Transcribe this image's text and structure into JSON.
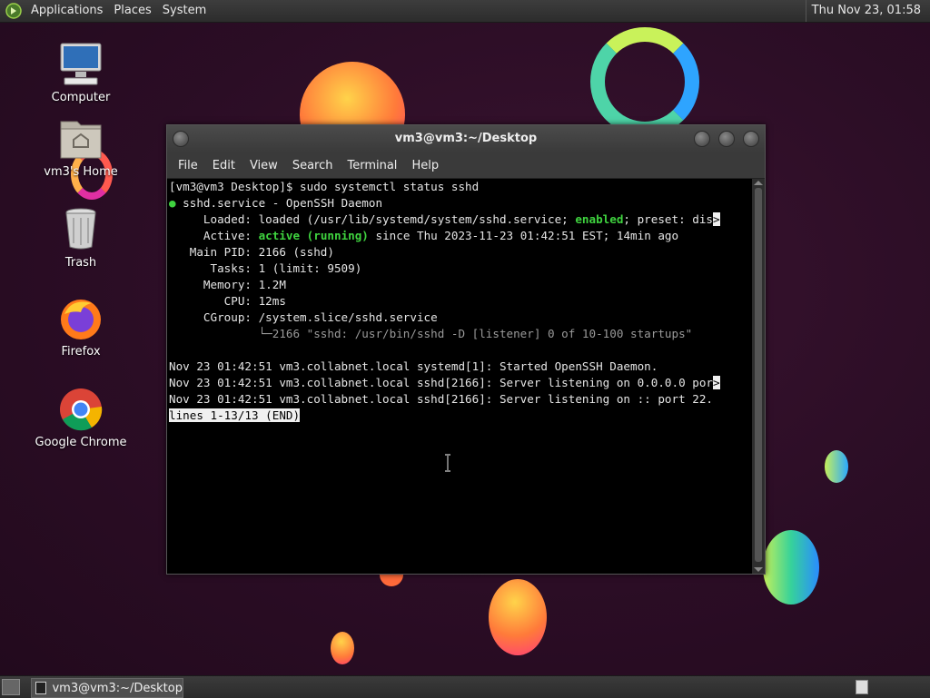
{
  "top_panel": {
    "menus": [
      "Applications",
      "Places",
      "System"
    ],
    "clock": "Thu Nov 23, 01:58"
  },
  "desktop_icons": [
    {
      "label": "Computer",
      "icon": "computer-icon"
    },
    {
      "label": "vm3's Home",
      "icon": "home-folder-icon"
    },
    {
      "label": "Trash",
      "icon": "trash-icon"
    },
    {
      "label": "Firefox",
      "icon": "firefox-icon"
    },
    {
      "label": "Google Chrome",
      "icon": "chrome-icon"
    }
  ],
  "window": {
    "title": "vm3@vm3:~/Desktop",
    "menus": [
      "File",
      "Edit",
      "View",
      "Search",
      "Terminal",
      "Help"
    ]
  },
  "terminal": {
    "prompt": "[vm3@vm3 Desktop]$ sudo systemctl status sshd",
    "service_dot": "●",
    "service_line": " sshd.service - OpenSSH Daemon",
    "loaded_pre": "     Loaded: loaded (/usr/lib/systemd/system/sshd.service; ",
    "loaded_enabled": "enabled",
    "loaded_post": "; preset: dis",
    "trunc_marker": ">",
    "active_pre": "     Active: ",
    "active_state": "active (running)",
    "active_post": " since Thu 2023-11-23 01:42:51 EST; 14min ago",
    "main_pid": "   Main PID: 2166 (sshd)",
    "tasks": "      Tasks: 1 (limit: 9509)",
    "memory": "     Memory: 1.2M",
    "cpu": "        CPU: 12ms",
    "cgroup": "     CGroup: /system.slice/sshd.service",
    "cgroup_child": "             └─2166 \"sshd: /usr/bin/sshd -D [listener] 0 of 10-100 startups\"",
    "log1": "Nov 23 01:42:51 vm3.collabnet.local systemd[1]: Started OpenSSH Daemon.",
    "log2": "Nov 23 01:42:51 vm3.collabnet.local sshd[2166]: Server listening on 0.0.0.0 por",
    "log3": "Nov 23 01:42:51 vm3.collabnet.local sshd[2166]: Server listening on :: port 22.",
    "pager_status": "lines 1-13/13 (END)"
  },
  "taskbar": {
    "task_label": "vm3@vm3:~/Desktop"
  },
  "colors": {
    "accent_green": "#3fd33f",
    "desktop_bg": "#2b0d25"
  }
}
